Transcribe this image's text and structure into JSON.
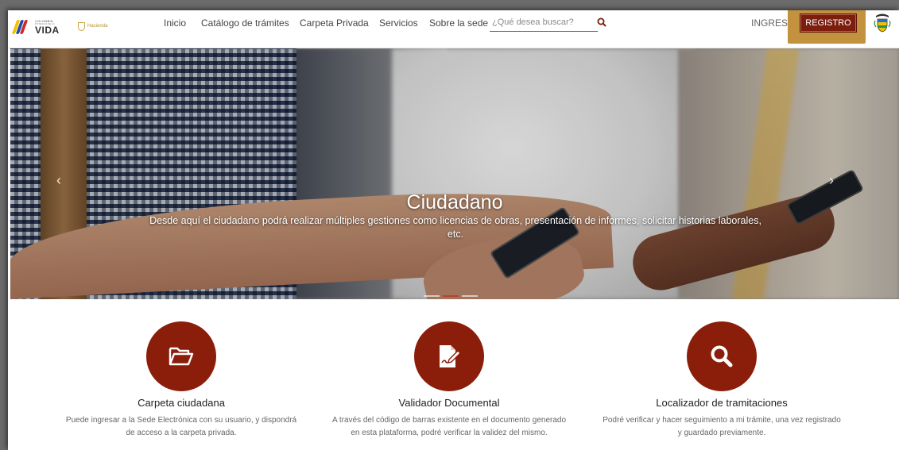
{
  "header": {
    "logo_vida": {
      "line1": "COLOMBIA",
      "line2": "POTENCIA DE LA",
      "main": "VIDA"
    },
    "logo_hacienda": "Hacienda",
    "nav": [
      "Inicio",
      "Catálogo de trámites",
      "Carpeta Privada",
      "Servicios",
      "Sobre la sede"
    ],
    "search_placeholder": "¿Qué desea buscar?",
    "ingresa_label": "INGRESA",
    "registro_label": "REGISTRO"
  },
  "hero": {
    "title": "Ciudadano",
    "subtitle": "Desde aquí el ciudadano podrá realizar múltiples gestiones como licencias de obras, presentación de informes, solicitar historias laborales, etc.",
    "prev": "‹",
    "next": "›",
    "active_slide": 2,
    "slide_count": 3
  },
  "cards": [
    {
      "icon": "folder-open-icon",
      "title": "Carpeta ciudadana",
      "description": "Puede ingresar a la Sede Electrónica con su usuario, y dispondrá de acceso a la carpeta privada."
    },
    {
      "icon": "document-sign-icon",
      "title": "Validador Documental",
      "description": "A través del código de barras existente en el documento generado en esta plataforma, podré verificar la validez del mismo."
    },
    {
      "icon": "search-icon",
      "title": "Localizador de tramitaciones",
      "description": "Podré verificar y hacer seguimiento a mi trámite, una vez registrado y guardado previamente."
    }
  ],
  "colors": {
    "brand": "#8b1e0b",
    "highlight": "#c2923e",
    "accent": "#b8442f"
  }
}
